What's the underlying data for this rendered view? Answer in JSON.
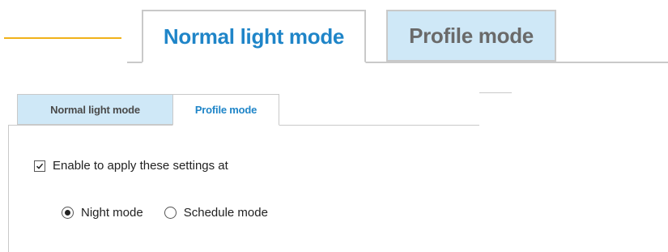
{
  "zoomed_tabs": {
    "active_label": "Normal light mode",
    "inactive_label": "Profile mode"
  },
  "tabs": {
    "normal_label": "Normal light mode",
    "profile_label": "Profile mode",
    "selected": "Profile mode"
  },
  "settings": {
    "enable_label": "Enable to apply these settings at",
    "enable_checked": true,
    "radio_options": [
      {
        "label": "Night mode",
        "selected": true
      },
      {
        "label": "Schedule mode",
        "selected": false
      }
    ]
  },
  "colors": {
    "callout": "#f0b21a",
    "tab_active_text": "#1f85c8",
    "tab_inactive_bg": "#cfe8f7"
  }
}
